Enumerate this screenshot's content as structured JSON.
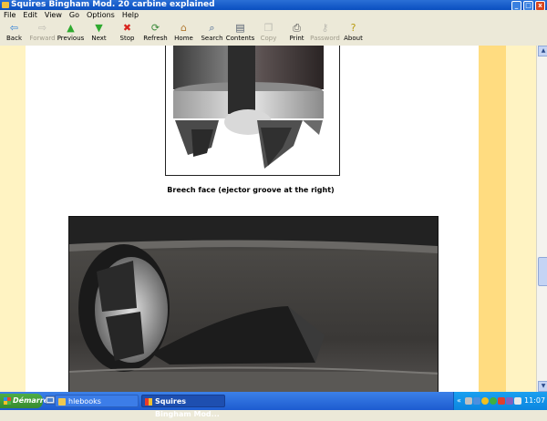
{
  "window": {
    "title": "Squires Bingham Mod. 20 carbine explained"
  },
  "window_buttons": {
    "minimize": "_",
    "maximize": "□",
    "close": "x"
  },
  "menu": [
    "File",
    "Edit",
    "View",
    "Go",
    "Options",
    "Help"
  ],
  "toolbar": {
    "buttons": [
      {
        "label": "Back",
        "icon": "back-arrow-icon",
        "glyph": "⇦",
        "color": "#2d7fd8",
        "enabled": true
      },
      {
        "label": "Forward",
        "icon": "forward-arrow-icon",
        "glyph": "⇨",
        "color": "#888888",
        "enabled": false
      },
      {
        "label": "Previous",
        "icon": "up-arrow-icon",
        "glyph": "▲",
        "color": "#2faa2f",
        "enabled": true
      },
      {
        "label": "Next",
        "icon": "down-arrow-icon",
        "glyph": "▼",
        "color": "#2faa2f",
        "enabled": true
      },
      {
        "label": "Stop",
        "icon": "stop-icon",
        "glyph": "✖",
        "color": "#d8231c",
        "enabled": true
      },
      {
        "label": "Refresh",
        "icon": "refresh-icon",
        "glyph": "⟳",
        "color": "#3a8a3a",
        "enabled": true
      },
      {
        "label": "Home",
        "icon": "home-icon",
        "glyph": "⌂",
        "color": "#b07830",
        "enabled": true
      },
      {
        "label": "Search",
        "icon": "search-icon",
        "glyph": "⌕",
        "color": "#406090",
        "enabled": true
      },
      {
        "label": "Contents",
        "icon": "contents-icon",
        "glyph": "▤",
        "color": "#556070",
        "enabled": true
      },
      {
        "label": "Copy",
        "icon": "copy-icon",
        "glyph": "❐",
        "color": "#888888",
        "enabled": false
      },
      {
        "label": "Print",
        "icon": "print-icon",
        "glyph": "⎙",
        "color": "#505050",
        "enabled": true
      },
      {
        "label": "Password",
        "icon": "key-icon",
        "glyph": "⚷",
        "color": "#888888",
        "enabled": false
      },
      {
        "label": "About",
        "icon": "help-icon",
        "glyph": "?",
        "color": "#b89a10",
        "enabled": true
      }
    ]
  },
  "content": {
    "caption": "Breech face (ejector groove at the right)"
  },
  "colors": {
    "stripe_light": "#fff3c2",
    "stripe_dark": "#ffdc80"
  },
  "taskbar": {
    "start_label": "Démarrer",
    "tasks": [
      {
        "label": "hlebooks",
        "icon": "folder-icon"
      },
      {
        "label": "Squires Bingham Mod...",
        "icon": "ebook-reader-icon"
      }
    ],
    "tray_arrow": "«",
    "clock": "11:07"
  }
}
